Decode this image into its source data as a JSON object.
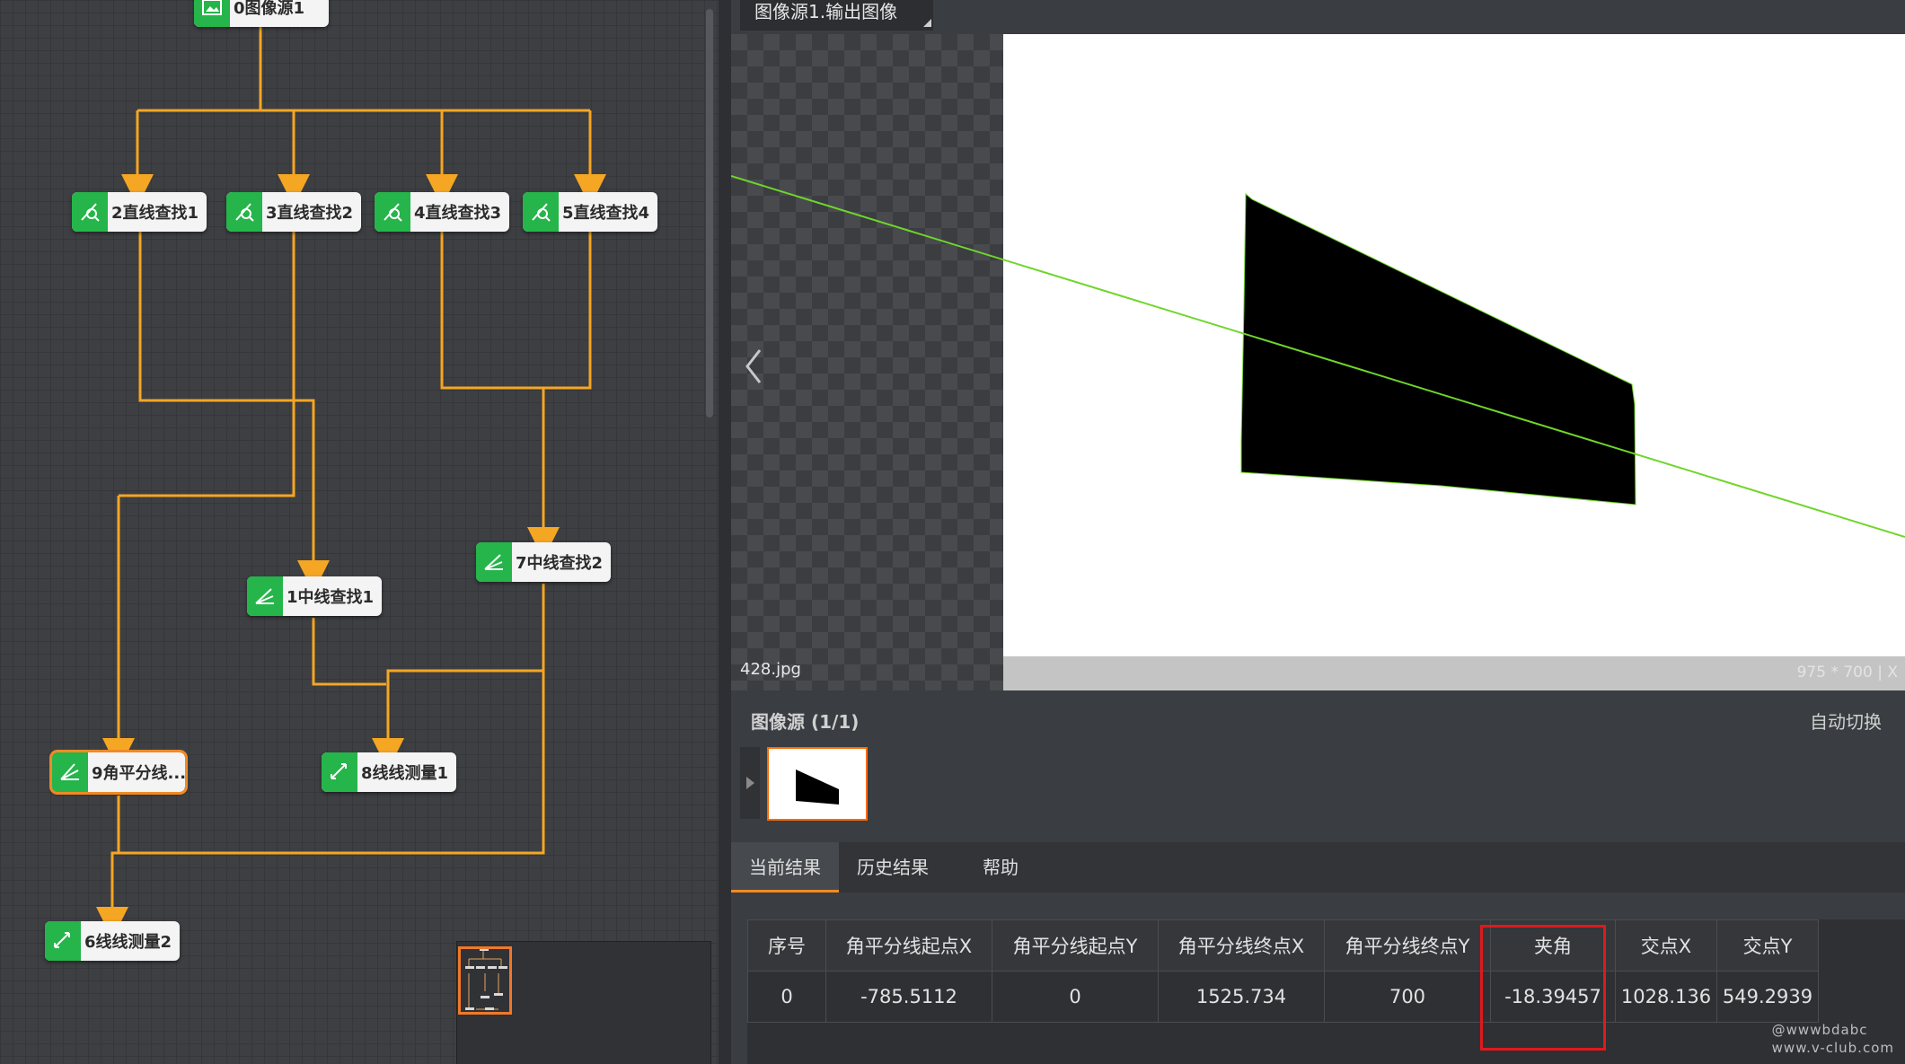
{
  "flow": {
    "nodes": [
      {
        "id": "n0",
        "label": "0图像源1",
        "icon": "image-icon"
      },
      {
        "id": "n2",
        "label": "2直线查找1",
        "icon": "line-find-icon"
      },
      {
        "id": "n3",
        "label": "3直线查找2",
        "icon": "line-find-icon"
      },
      {
        "id": "n4",
        "label": "4直线查找3",
        "icon": "line-find-icon"
      },
      {
        "id": "n5",
        "label": "5直线查找4",
        "icon": "line-find-icon"
      },
      {
        "id": "n7",
        "label": "7中线查找2",
        "icon": "midline-icon"
      },
      {
        "id": "n1",
        "label": "1中线查找1",
        "icon": "midline-icon"
      },
      {
        "id": "n9",
        "label": "9角平分线...",
        "icon": "bisector-icon"
      },
      {
        "id": "n8",
        "label": "8线线测量1",
        "icon": "measure-icon"
      },
      {
        "id": "n6",
        "label": "6线线测量2",
        "icon": "measure-icon"
      }
    ],
    "selected": "9角平分线...",
    "edge_color": "#f5a623"
  },
  "viewer": {
    "tab_title": "图像源1.输出图像",
    "filename": "428.jpg",
    "image_size": "975 * 700  |  X"
  },
  "source_strip": {
    "title": "图像源 (1/1)",
    "auto_switch": "自动切换"
  },
  "result_tabs": [
    "当前结果",
    "历史结果",
    "帮助"
  ],
  "results": {
    "columns": [
      "序号",
      "角平分线起点X",
      "角平分线起点Y",
      "角平分线终点X",
      "角平分线终点Y",
      "夹角",
      "交点X",
      "交点Y"
    ],
    "rows": [
      [
        "0",
        "-785.5112",
        "0",
        "1525.734",
        "700",
        "-18.39457",
        "1028.136",
        "549.2939"
      ]
    ],
    "highlighted_column": "夹角"
  },
  "watermark": [
    "@wwwbdabc",
    "www.v-club.com"
  ],
  "colors": {
    "accent": "#f08a24",
    "node_icon": "#25b54a",
    "highlight": "#e0191c",
    "bisector_line": "#6fd62a"
  }
}
